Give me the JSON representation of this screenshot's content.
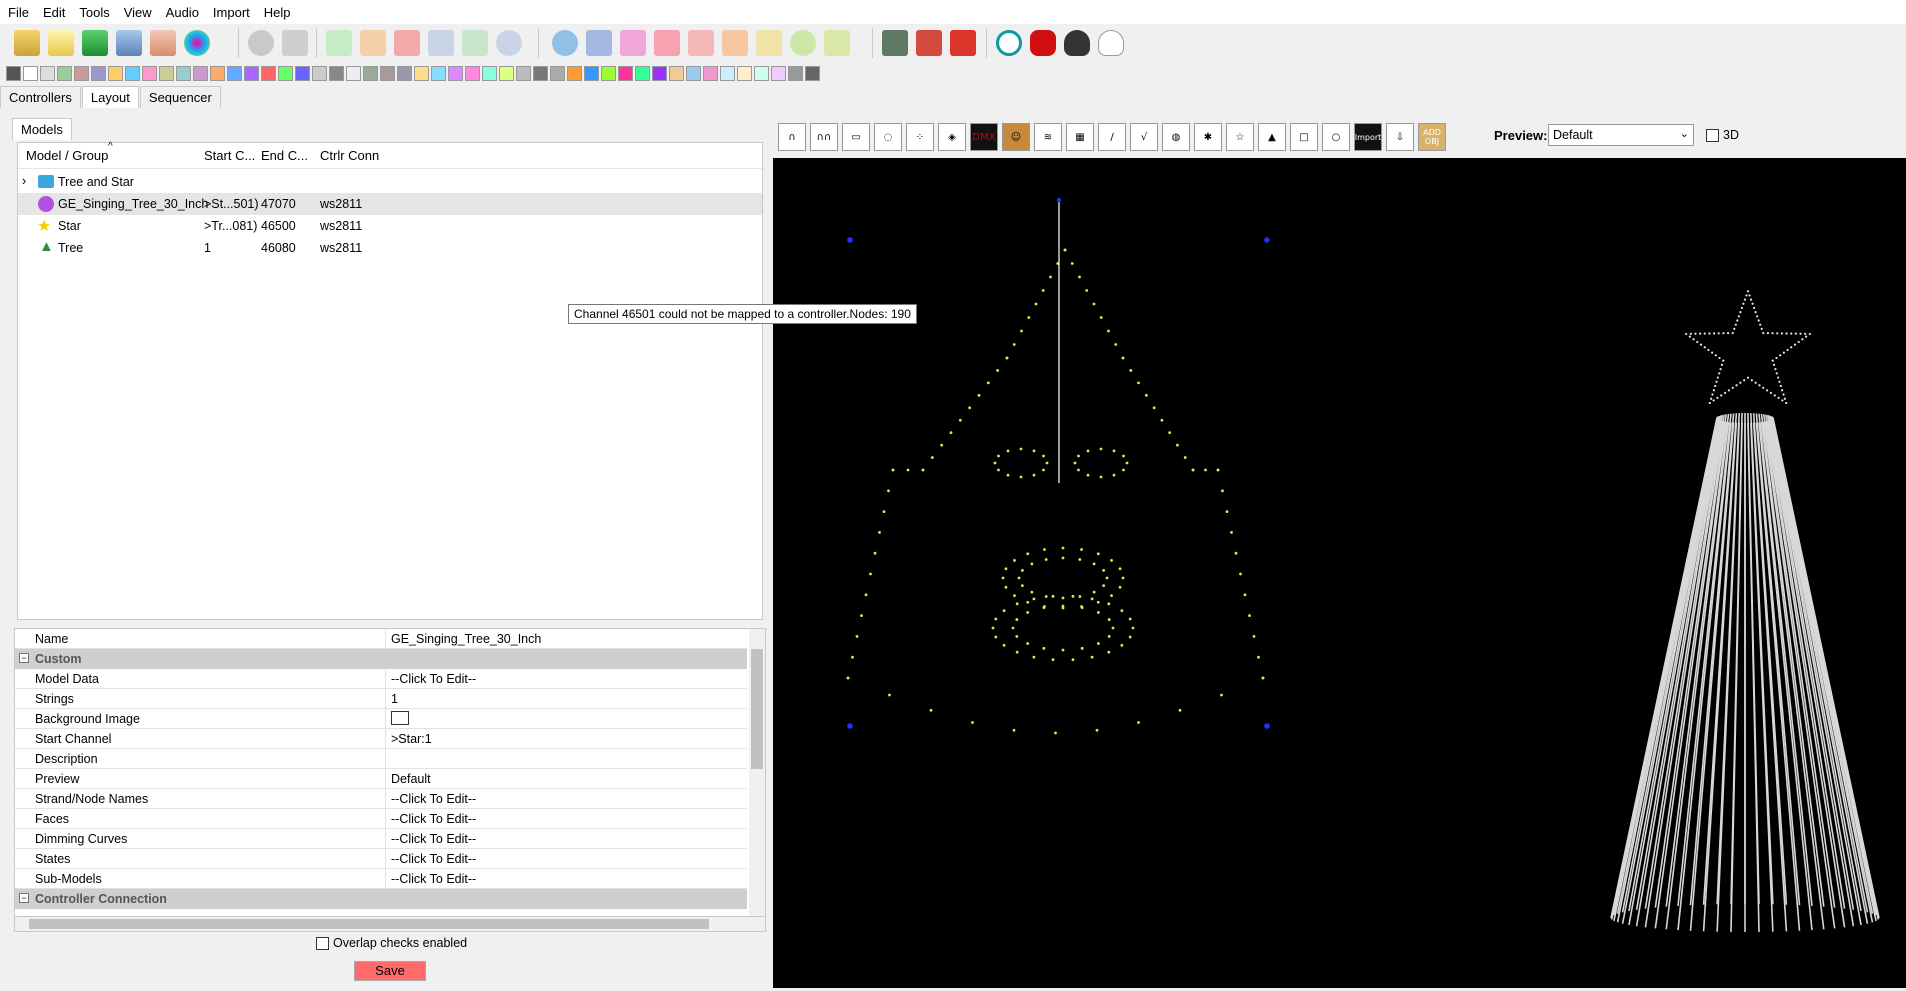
{
  "menu": [
    "File",
    "Edit",
    "Tools",
    "View",
    "Audio",
    "Import",
    "Help"
  ],
  "tabs": [
    "Controllers",
    "Layout",
    "Sequencer"
  ],
  "active_tab": "Layout",
  "models_tab": "Models",
  "tree": {
    "columns": [
      "Model / Group",
      "Start C...",
      "End C...",
      "Ctrlr Conn"
    ],
    "rows": [
      {
        "name": "Tree and Star",
        "start": "",
        "end": "",
        "conn": "",
        "icon": "folder-icon"
      },
      {
        "name": "GE_Singing_Tree_30_Inch",
        "start": ">St...501)",
        "end": "47070",
        "conn": "ws2811",
        "icon": "face-icon"
      },
      {
        "name": "Star",
        "start": ">Tr...081)",
        "end": "46500",
        "conn": "ws2811",
        "icon": "star-icon"
      },
      {
        "name": "Tree",
        "start": "1",
        "end": "46080",
        "conn": "ws2811",
        "icon": "tree-icon"
      }
    ]
  },
  "tooltip": "Channel 46501 could not be mapped to a controller.Nodes: 190",
  "properties": {
    "name_label": "Name",
    "name_value": "GE_Singing_Tree_30_Inch",
    "cat_custom": "Custom",
    "items": [
      {
        "label": "Model Data",
        "value": "--Click To Edit--"
      },
      {
        "label": "Strings",
        "value": "1"
      },
      {
        "label": "Background Image",
        "value": ""
      },
      {
        "label": "Start Channel",
        "value": ">Star:1"
      },
      {
        "label": "Description",
        "value": ""
      },
      {
        "label": "Preview",
        "value": "Default"
      },
      {
        "label": "Strand/Node Names",
        "value": "--Click To Edit--"
      },
      {
        "label": "Faces",
        "value": "--Click To Edit--"
      },
      {
        "label": "Dimming Curves",
        "value": "--Click To Edit--"
      },
      {
        "label": "States",
        "value": "--Click To Edit--"
      },
      {
        "label": "Sub-Models",
        "value": "--Click To Edit--"
      }
    ],
    "cat_controller": "Controller Connection"
  },
  "overlap_label": "Overlap checks enabled",
  "save_label": "Save",
  "preview": {
    "label": "Preview:",
    "value": "Default",
    "threed_label": "3D"
  },
  "right_toolbar_text": {
    "dmx": "DMX",
    "import": "Import",
    "add_obj": "ADD OBJ"
  },
  "colors": {
    "canvas": "#000000",
    "node": "#e8e840",
    "handle": "#2030ff",
    "save": "#ff6b6b",
    "selected_row": "#e5e5e5"
  }
}
